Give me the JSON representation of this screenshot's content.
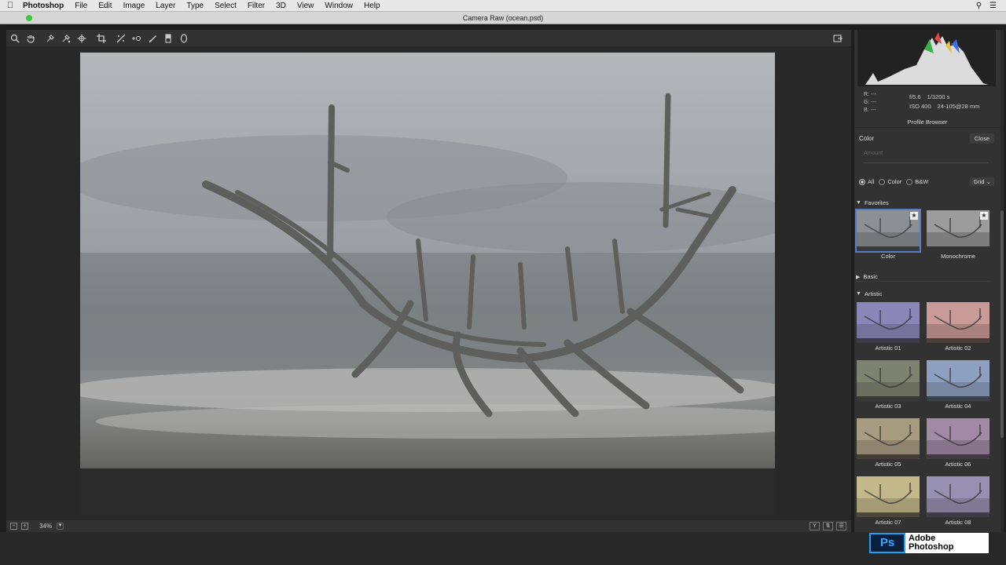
{
  "menubar": {
    "app": "Photoshop",
    "items": [
      "File",
      "Edit",
      "Image",
      "Layer",
      "Type",
      "Select",
      "Filter",
      "3D",
      "View",
      "Window",
      "Help"
    ]
  },
  "window": {
    "title": "Camera Raw (ocean.psd)"
  },
  "toolbar": {
    "tools": [
      "zoom-icon",
      "hand-icon",
      "white-balance-icon",
      "color-sampler-icon",
      "targeted-adjustment-icon",
      "crop-icon",
      "straighten-icon",
      "spot-removal-icon",
      "red-eye-icon",
      "adjustment-brush-icon",
      "graduated-filter-icon",
      "radial-filter-icon"
    ]
  },
  "status": {
    "zoom": "34%"
  },
  "histogram": {
    "r_label": "R:",
    "g_label": "G:",
    "b_label": "B:",
    "r": "---",
    "g": "---",
    "b": "---",
    "aperture": "f/5.6",
    "shutter": "1/3200 s",
    "iso": "ISO 400",
    "lens": "24-105@28 mm"
  },
  "profile_browser": {
    "title": "Profile Browser",
    "current": "Color",
    "close_label": "Close",
    "amount_placeholder": "Amount",
    "filters": {
      "all": "All",
      "color": "Color",
      "bw": "B&W",
      "view": "Grid"
    },
    "favorites_label": "Favorites",
    "favorites": [
      {
        "label": "Color",
        "selected": true
      },
      {
        "label": "Monochrome",
        "selected": false
      }
    ],
    "basic_label": "Basic",
    "artistic_label": "Artistic",
    "artistic": [
      {
        "label": "Artistic 01",
        "tint": "#8a86b8"
      },
      {
        "label": "Artistic 02",
        "tint": "#c89a98"
      },
      {
        "label": "Artistic 03",
        "tint": "#7e8270"
      },
      {
        "label": "Artistic 04",
        "tint": "#8ea0c0"
      },
      {
        "label": "Artistic 05",
        "tint": "#a89c80"
      },
      {
        "label": "Artistic 06",
        "tint": "#a08aa4"
      },
      {
        "label": "Artistic 07",
        "tint": "#c2b88a"
      },
      {
        "label": "Artistic 08",
        "tint": "#9890b0"
      }
    ]
  },
  "brand": {
    "ps": "Ps",
    "line1": "Adobe",
    "line2": "Photoshop"
  }
}
